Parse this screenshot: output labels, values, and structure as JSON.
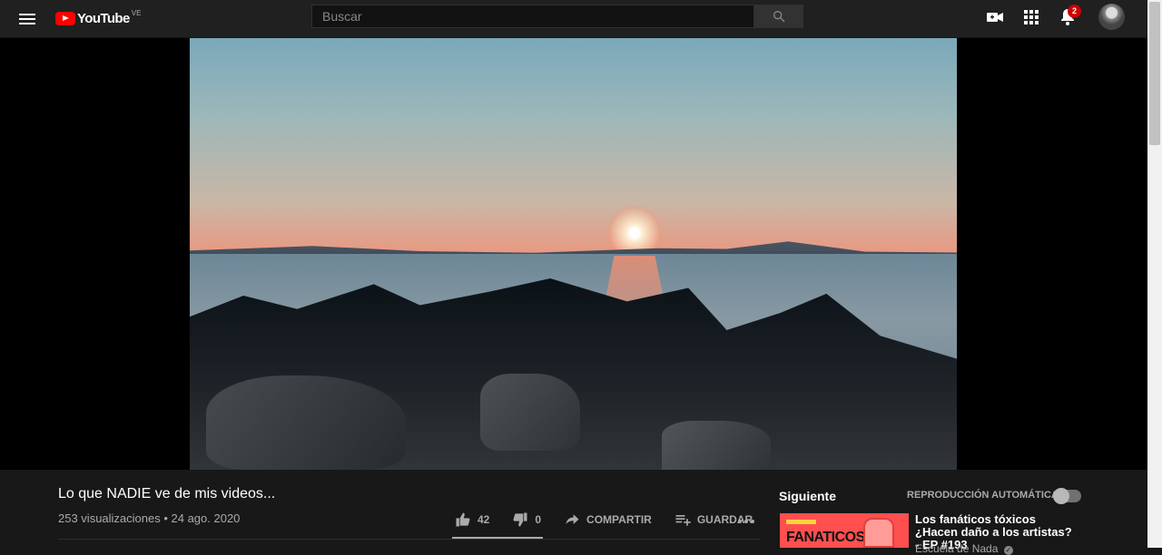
{
  "header": {
    "logo_text": "YouTube",
    "country": "VE",
    "search_placeholder": "Buscar",
    "notifications_count": "2",
    "icons": [
      "menu-icon",
      "camera-icon",
      "apps-icon",
      "bell-icon",
      "search-icon"
    ]
  },
  "video": {
    "title": "Lo que NADIE ve de mis videos...",
    "meta": "253 visualizaciones • 24 ago. 2020",
    "likes": "42",
    "dislikes": "0",
    "share_label": "COMPARTIR",
    "save_label": "GUARDAR"
  },
  "sidebar": {
    "next_label": "Siguiente",
    "autoplay_label": "REPRODUCCIÓN AUTOMÁTICA",
    "autoplay_enabled": false,
    "related": [
      {
        "thumbnail_text": "FANATICOS",
        "title": "Los fanáticos tóxicos ¿Hacen daño a los artistas? - EP #193",
        "channel": "Escuela de Nada"
      }
    ]
  },
  "colors": {
    "background": "#181818",
    "topbar": "#202020",
    "brand_red": "#ff0000",
    "thumbnail_red": "#ff4f4f"
  }
}
